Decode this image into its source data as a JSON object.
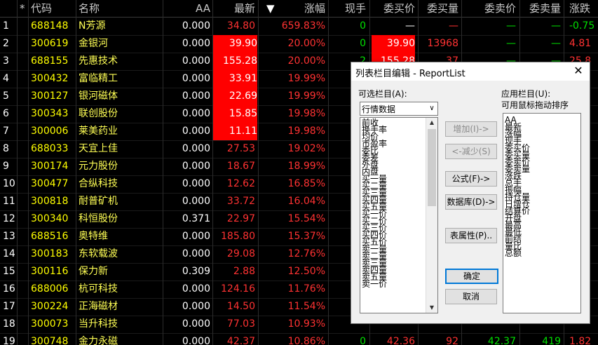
{
  "colors": {
    "red_bg": "#ff0000",
    "code_yellow": "#ffff00",
    "name_yellow": "#ffff55",
    "up_red": "#ff3232",
    "zero_green": "#00e000",
    "neutral_white": "#ffffff"
  },
  "table": {
    "headers": {
      "row": "",
      "star": "*",
      "code": "代码",
      "name": "名称",
      "aa": "AA",
      "latest": "最新",
      "sort_arrow": "▼",
      "change_pct": "涨幅",
      "volume_now": "现手",
      "bid_price": "委买价",
      "bid_vol": "委买量",
      "ask_price": "委卖价",
      "ask_vol": "委卖量",
      "change": "涨跌"
    },
    "rows": [
      {
        "n": "1",
        "code": "688148",
        "name": "N芳源",
        "aa": "0.000",
        "latest": "34.80",
        "pct": "659.83%",
        "vol": "0",
        "bid": "—",
        "bidv": "—",
        "ask": "—",
        "askv": "—",
        "chg": "-0.75"
      },
      {
        "n": "2",
        "code": "300619",
        "name": "金银河",
        "aa": "0.000",
        "latest": "39.90",
        "pct": "20.00%",
        "vol": "0",
        "bid": "39.90",
        "bidv": "13968",
        "ask": "—",
        "askv": "—",
        "chg": "4.81"
      },
      {
        "n": "3",
        "code": "688155",
        "name": "先惠技术",
        "aa": "0.000",
        "latest": "155.28",
        "pct": "20.00%",
        "vol": "2",
        "bid": "155.28",
        "bidv": "37",
        "ask": "—",
        "askv": "—",
        "chg": "25.8"
      },
      {
        "n": "4",
        "code": "300432",
        "name": "富临精工",
        "aa": "0.000",
        "latest": "33.91",
        "pct": "19.99%",
        "vol": "",
        "bid": "",
        "bidv": "",
        "ask": "",
        "askv": "",
        "chg": ""
      },
      {
        "n": "5",
        "code": "300127",
        "name": "银河磁体",
        "aa": "0.000",
        "latest": "22.69",
        "pct": "19.99%",
        "vol": "",
        "bid": "",
        "bidv": "",
        "ask": "",
        "askv": "",
        "chg": ""
      },
      {
        "n": "6",
        "code": "300343",
        "name": "联创股份",
        "aa": "0.000",
        "latest": "15.85",
        "pct": "19.98%",
        "vol": "",
        "bid": "",
        "bidv": "",
        "ask": "",
        "askv": "",
        "chg": ""
      },
      {
        "n": "7",
        "code": "300006",
        "name": "莱美药业",
        "aa": "0.000",
        "latest": "11.11",
        "pct": "19.98%",
        "vol": "",
        "bid": "",
        "bidv": "",
        "ask": "",
        "askv": "",
        "chg": ""
      },
      {
        "n": "8",
        "code": "688033",
        "name": "天宜上佳",
        "aa": "0.000",
        "latest": "27.53",
        "pct": "19.02%",
        "vol": "",
        "bid": "",
        "bidv": "",
        "ask": "",
        "askv": "",
        "chg": ""
      },
      {
        "n": "9",
        "code": "300174",
        "name": "元力股份",
        "aa": "0.000",
        "latest": "18.67",
        "pct": "18.99%",
        "vol": "",
        "bid": "",
        "bidv": "",
        "ask": "",
        "askv": "",
        "chg": ""
      },
      {
        "n": "10",
        "code": "300477",
        "name": "合纵科技",
        "aa": "0.000",
        "latest": "12.62",
        "pct": "16.85%",
        "vol": "",
        "bid": "",
        "bidv": "",
        "ask": "",
        "askv": "",
        "chg": ""
      },
      {
        "n": "11",
        "code": "300818",
        "name": "耐普矿机",
        "aa": "0.000",
        "latest": "33.72",
        "pct": "16.04%",
        "vol": "",
        "bid": "",
        "bidv": "",
        "ask": "",
        "askv": "",
        "chg": ""
      },
      {
        "n": "12",
        "code": "300340",
        "name": "科恒股份",
        "aa": "0.371",
        "latest": "22.97",
        "pct": "15.54%",
        "vol": "",
        "bid": "",
        "bidv": "",
        "ask": "",
        "askv": "",
        "chg": ""
      },
      {
        "n": "13",
        "code": "688516",
        "name": "奥特维",
        "aa": "0.000",
        "latest": "185.80",
        "pct": "15.37%",
        "vol": "",
        "bid": "",
        "bidv": "",
        "ask": "",
        "askv": "",
        "chg": ""
      },
      {
        "n": "14",
        "code": "300183",
        "name": "东软载波",
        "aa": "0.000",
        "latest": "29.08",
        "pct": "12.76%",
        "vol": "",
        "bid": "",
        "bidv": "",
        "ask": "",
        "askv": "",
        "chg": ""
      },
      {
        "n": "15",
        "code": "300116",
        "name": "保力新",
        "aa": "0.309",
        "latest": "2.88",
        "pct": "12.50%",
        "vol": "",
        "bid": "",
        "bidv": "",
        "ask": "",
        "askv": "",
        "chg": ""
      },
      {
        "n": "16",
        "code": "688006",
        "name": "杭可科技",
        "aa": "0.000",
        "latest": "124.16",
        "pct": "11.76%",
        "vol": "",
        "bid": "",
        "bidv": "",
        "ask": "",
        "askv": "",
        "chg": ""
      },
      {
        "n": "17",
        "code": "300224",
        "name": "正海磁材",
        "aa": "0.000",
        "latest": "14.50",
        "pct": "11.54%",
        "vol": "",
        "bid": "",
        "bidv": "",
        "ask": "",
        "askv": "",
        "chg": ""
      },
      {
        "n": "18",
        "code": "300073",
        "name": "当升科技",
        "aa": "0.000",
        "latest": "77.03",
        "pct": "10.93%",
        "vol": "",
        "bid": "",
        "bidv": "",
        "ask": "",
        "askv": "",
        "chg": ""
      },
      {
        "n": "19",
        "code": "300748",
        "name": "金力永磁",
        "aa": "0.000",
        "latest": "42.37",
        "pct": "10.86%",
        "vol": "0",
        "bid": "42.36",
        "bidv": "92",
        "ask": "42.37",
        "askv": "419",
        "chg": "1.82"
      }
    ]
  },
  "dialog": {
    "title": "列表栏目编辑 - ReportList",
    "close_glyph": "✕",
    "available_label": "可选栏目(A):",
    "category_value": "行情数据",
    "applied_label": "应用栏目(U):",
    "applied_hint": "可用鼠标拖动排序",
    "available_items": [
      "前收",
      "换手率",
      "均价",
      "市盈率",
      "委比",
      "委差",
      "外盘",
      "内盘",
      "买一量",
      "买二量",
      "买三量",
      "买四量",
      "买五量",
      "买一价",
      "买二价",
      "买三价",
      "买四价",
      "买五价",
      "卖一量",
      "卖二量",
      "卖三量",
      "卖四量",
      "卖五量",
      "卖一价"
    ],
    "applied_items": [
      "AA",
      "最新",
      "涨幅",
      "现手",
      "委买价",
      "委买量",
      "委卖价",
      "委卖量",
      "涨跌",
      "总手",
      "振幅",
      "持仓量",
      "日增仓",
      "结算价",
      "开盘",
      "最高",
      "最低",
      "前结",
      "量比",
      "总额"
    ],
    "buttons": {
      "add": "增加(I)->",
      "remove": "<-减少(S)",
      "formula": "公式(F)->",
      "database": "数据库(D)->",
      "table_prop": "表属性(P)..",
      "ok": "确定",
      "cancel": "取消"
    }
  }
}
